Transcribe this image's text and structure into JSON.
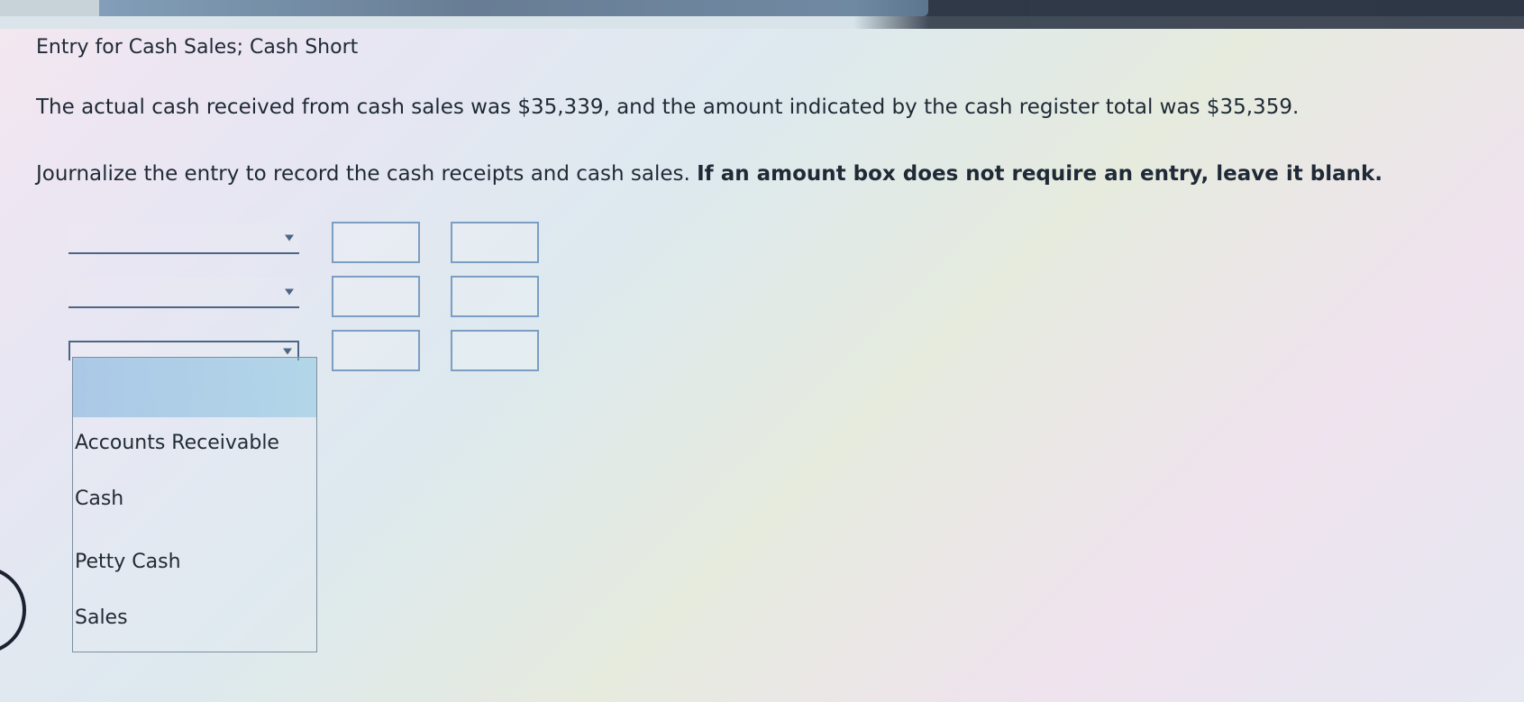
{
  "header": {
    "title": "Entry for Cash Sales; Cash Short"
  },
  "problem": {
    "text": "The actual cash received from cash sales was $35,339, and the amount indicated by the cash register total was $35,359.",
    "instruction_plain": "Journalize the entry to record the cash receipts and cash sales.",
    "instruction_bold": "If an amount box does not require an entry, leave it blank."
  },
  "journal": {
    "rows": [
      {
        "account": "",
        "debit": "",
        "credit": ""
      },
      {
        "account": "",
        "debit": "",
        "credit": ""
      },
      {
        "account": "",
        "debit": "",
        "credit": ""
      }
    ]
  },
  "dropdown": {
    "options": [
      "Accounts Receivable",
      "Cash",
      "Petty Cash",
      "Sales"
    ]
  },
  "colors": {
    "accent": "#4d6585",
    "border": "#7b9ec2",
    "highlight": "#7fb5dc"
  }
}
